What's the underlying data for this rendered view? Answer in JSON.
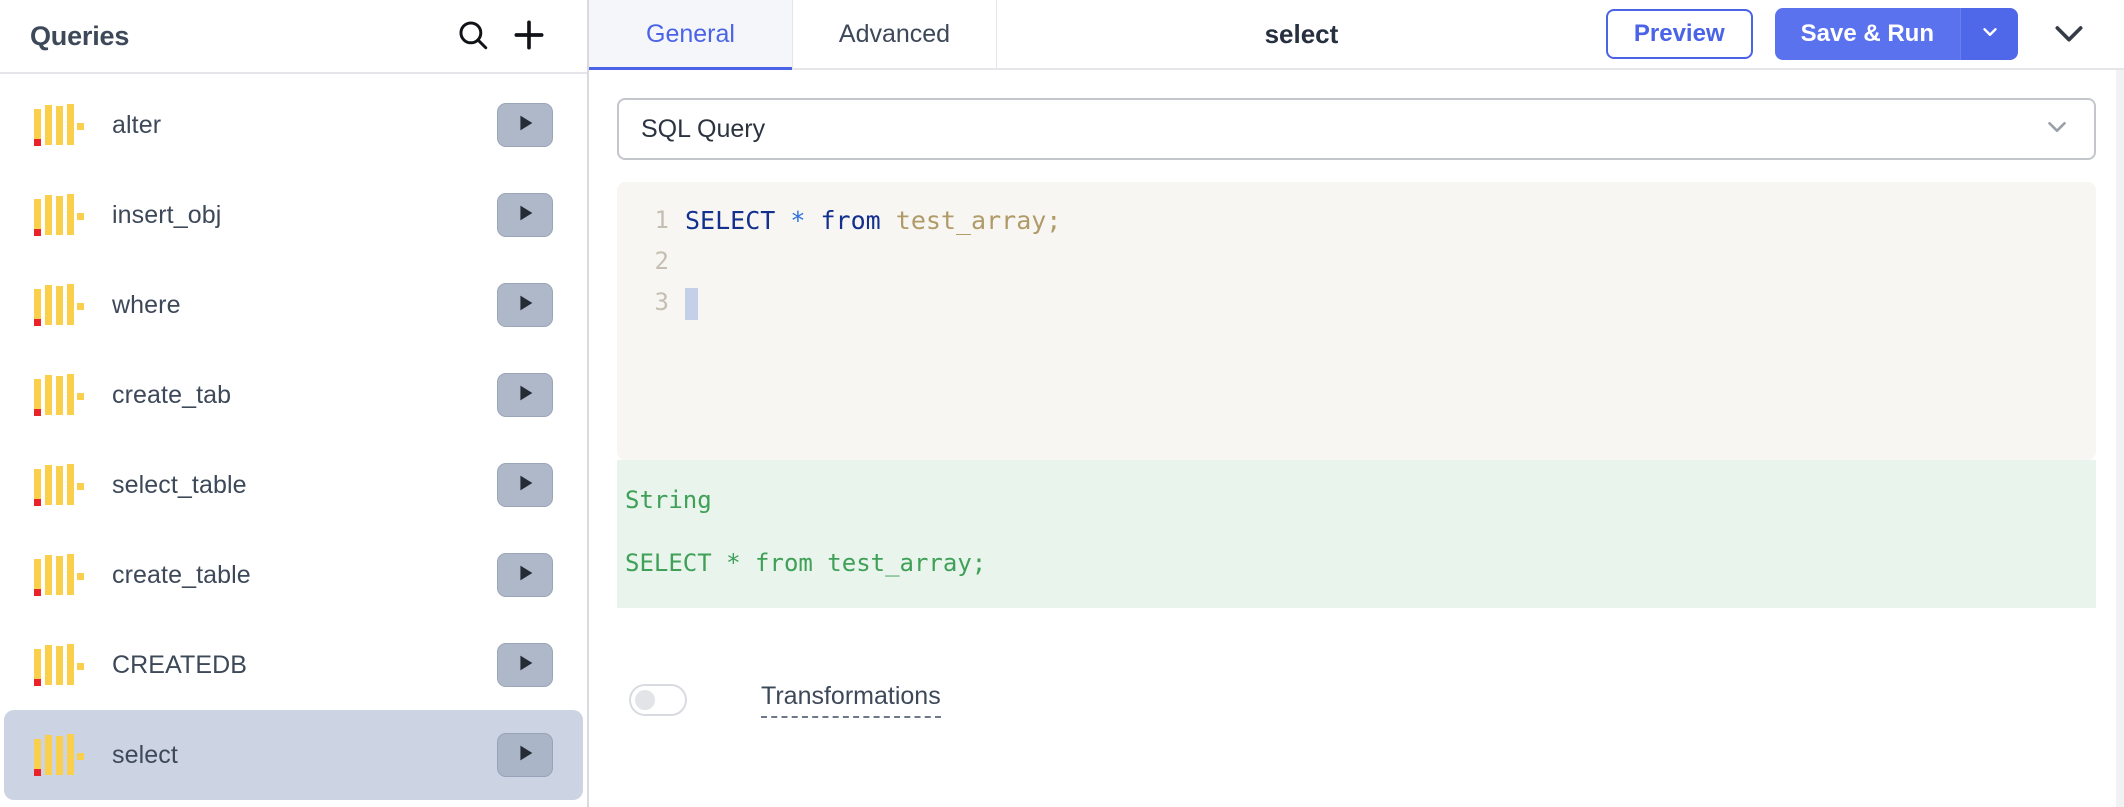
{
  "sidebar": {
    "title": "Queries",
    "search_icon": "search-icon",
    "add_icon": "plus-icon",
    "run_icon": "play-icon",
    "item_icon": "query-bars-icon",
    "items": [
      {
        "label": "alter",
        "selected": false
      },
      {
        "label": "insert_obj",
        "selected": false
      },
      {
        "label": "where",
        "selected": false
      },
      {
        "label": "create_tab",
        "selected": false
      },
      {
        "label": "select_table",
        "selected": false
      },
      {
        "label": "create_table",
        "selected": false
      },
      {
        "label": "CREATEDB",
        "selected": false
      },
      {
        "label": "select",
        "selected": true
      }
    ]
  },
  "header": {
    "tabs": [
      {
        "label": "General",
        "active": true
      },
      {
        "label": "Advanced",
        "active": false
      }
    ],
    "title": "select",
    "preview_label": "Preview",
    "save_run_label": "Save & Run",
    "save_run_caret_icon": "chevron-down-icon",
    "collapse_icon": "chevron-down-icon"
  },
  "body": {
    "query_type": {
      "value": "SQL Query",
      "caret_icon": "chevron-down-icon"
    },
    "editor": {
      "lines": [
        {
          "number": "1",
          "tokens": [
            {
              "text": "SELECT",
              "type": "kw"
            },
            {
              "text": " ",
              "type": "plain"
            },
            {
              "text": "*",
              "type": "star"
            },
            {
              "text": " ",
              "type": "plain"
            },
            {
              "text": "from",
              "type": "kw"
            },
            {
              "text": " ",
              "type": "plain"
            },
            {
              "text": "test_array",
              "type": "id"
            },
            {
              "text": ";",
              "type": "punc"
            }
          ]
        },
        {
          "number": "2",
          "tokens": []
        },
        {
          "number": "3",
          "tokens": [],
          "cursor": true
        }
      ]
    },
    "result": {
      "type_label": "String",
      "value": "SELECT * from test_array;"
    },
    "transformations": {
      "label": "Transformations",
      "enabled": false
    }
  },
  "colors": {
    "accent": "#4a63e7",
    "save_run_bg": "#5b72ef",
    "selected_row_bg": "#ccd4e3",
    "editor_bg": "#f8f6f2",
    "result_bg": "#e9f4ec",
    "result_text": "#3fa057",
    "icon_yellow": "#f9cf4c",
    "icon_red": "#e8232a",
    "text_primary": "#3d4859"
  }
}
